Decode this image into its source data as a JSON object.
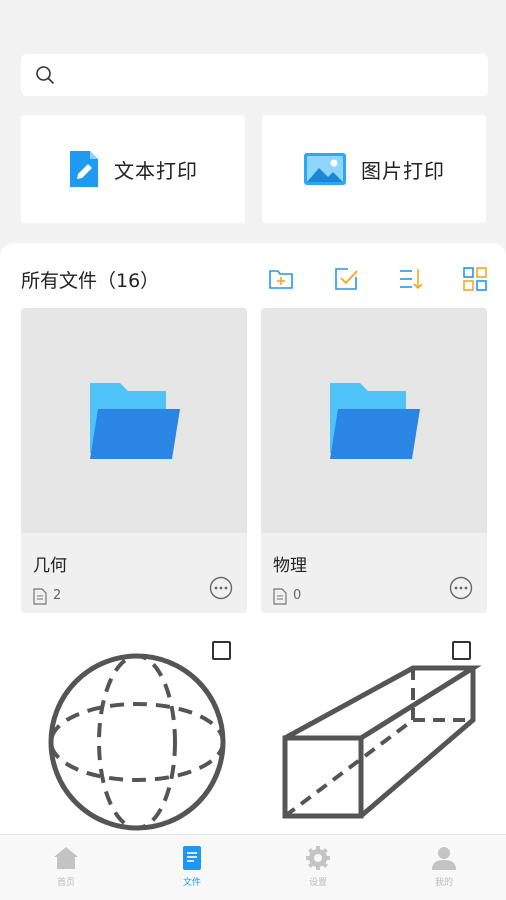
{
  "search": {
    "placeholder": ""
  },
  "quick_actions": [
    {
      "label": "文本打印",
      "icon": "document-edit-icon"
    },
    {
      "label": "图片打印",
      "icon": "image-icon"
    }
  ],
  "files": {
    "title": "所有文件（16）",
    "toolbar_icons": [
      "new-folder-icon",
      "select-icon",
      "sort-icon",
      "grid-view-icon"
    ],
    "folders": [
      {
        "name": "几何",
        "count": "2"
      },
      {
        "name": "物理",
        "count": "0"
      }
    ],
    "items": [
      {
        "icon": "sphere-icon"
      },
      {
        "icon": "cuboid-icon"
      }
    ]
  },
  "tabbar": {
    "tabs": [
      {
        "label": "首页",
        "icon": "home-icon"
      },
      {
        "label": "文件",
        "icon": "file-icon",
        "active": true
      },
      {
        "label": "设置",
        "icon": "settings-icon"
      },
      {
        "label": "我的",
        "icon": "profile-icon"
      }
    ]
  },
  "colors": {
    "accent": "#2196f3",
    "toolbar_orange": "#f5a623",
    "background": "#f2f2f2"
  }
}
